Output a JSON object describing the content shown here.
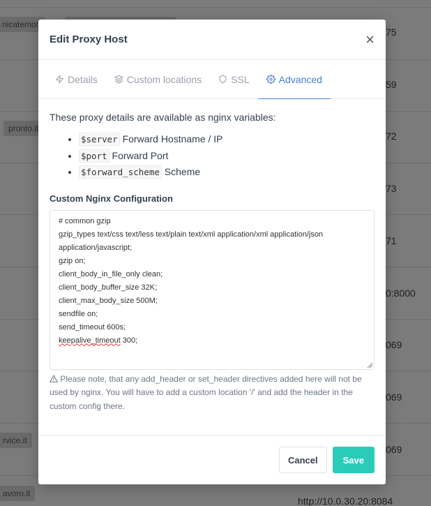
{
  "background": {
    "tags": [
      "nicatemoti",
      "pronto.it",
      "rvice.it",
      "avoro.it"
    ],
    "values": [
      "75",
      "59",
      "72",
      "73",
      "71",
      "0:8000",
      "069",
      "069",
      "069",
      "http://10.0.30.20:8084"
    ]
  },
  "modal": {
    "title": "Edit Proxy Host",
    "close_label": "×",
    "tabs": [
      {
        "label": "Details",
        "icon": "bolt-icon"
      },
      {
        "label": "Custom locations",
        "icon": "layers-icon"
      },
      {
        "label": "SSL",
        "icon": "shield-icon"
      },
      {
        "label": "Advanced",
        "icon": "gear-icon"
      }
    ],
    "active_tab": "Advanced",
    "intro": "These proxy details are available as nginx variables:",
    "variables": [
      {
        "code": "$server",
        "desc": "Forward Hostname / IP"
      },
      {
        "code": "$port",
        "desc": "Forward Port"
      },
      {
        "code": "$forward_scheme",
        "desc": "Scheme"
      }
    ],
    "config_label": "Custom Nginx Configuration",
    "config_lines": [
      "# common gzip",
      "gzip_types text/css text/less text/plain text/xml application/xml application/json",
      "application/javascript;",
      "gzip on;",
      "client_body_in_file_only clean;",
      "client_body_buffer_size 32K;",
      "client_max_body_size 500M;",
      "sendfile on;",
      "send_timeout 600s;"
    ],
    "config_last_key": "keepalive_timeout",
    "config_last_value": " 300;",
    "note": "Please note, that any add_header or set_header directives added here will not be used by nginx. You will have to add a custom location '/' and add the header in the custom config there.",
    "cancel_label": "Cancel",
    "save_label": "Save"
  },
  "colors": {
    "accent": "#467fcf",
    "save": "#2bcbba"
  }
}
